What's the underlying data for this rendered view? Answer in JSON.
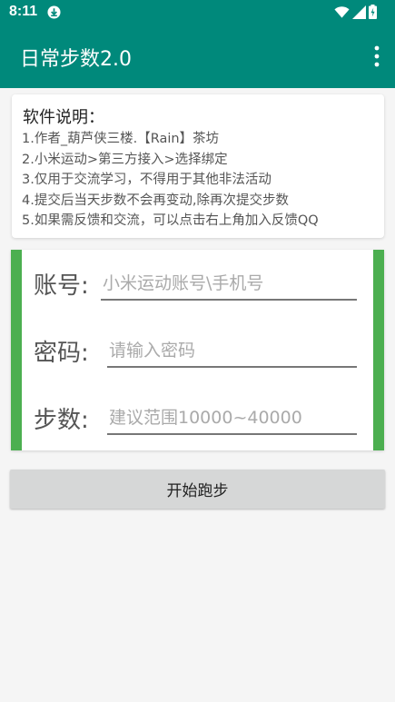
{
  "status_bar": {
    "time": "8:11",
    "icons": [
      "download-icon",
      "wifi-icon",
      "cell-signal-icon",
      "battery-icon"
    ]
  },
  "app_bar": {
    "title": "日常步数2.0",
    "menu_icon": "overflow-menu-icon"
  },
  "info": {
    "title": "软件说明：",
    "lines": [
      "1.作者_葫芦侠三楼.【Rain】茶坊",
      "2.小米运动>第三方接入>选择绑定",
      "3.仅用于交流学习，不得用于其他非法活动",
      "4.提交后当天步数不会再变动,除再次提交步数",
      "5.如果需反馈和交流，可以点击右上角加入反馈QQ"
    ]
  },
  "form": {
    "account_label": "账号:",
    "account_placeholder": "小米运动账号\\手机号",
    "password_label": "密码:",
    "password_placeholder": "请输入密码",
    "steps_label": "步数:",
    "steps_placeholder": "建议范围10000~40000"
  },
  "actions": {
    "start_label": "开始跑步"
  },
  "colors": {
    "primary": "#00897b",
    "accent_bar": "#4caf50",
    "background": "#f5f5f5",
    "button": "#d6d7d7"
  }
}
